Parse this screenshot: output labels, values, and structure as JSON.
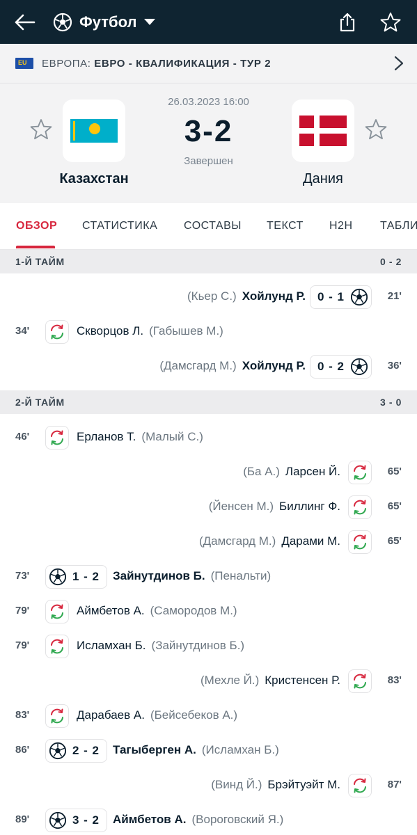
{
  "topbar": {
    "sport": "Футбол"
  },
  "league": {
    "country": "ЕВРОПА:",
    "competition": "ЕВРО - КВАЛИФИКАЦИЯ - ТУР 2",
    "flag_label": "EU"
  },
  "match": {
    "datetime": "26.03.2023 16:00",
    "score": "3-2",
    "status": "Завершен",
    "home": "Казахстан",
    "away": "Дания"
  },
  "tabs": [
    "ОБЗОР",
    "СТАТИСТИКА",
    "СОСТАВЫ",
    "ТЕКСТ",
    "H2H",
    "ТАБЛИ"
  ],
  "sections": [
    {
      "label": "1-Й ТАЙМ",
      "score": "0 - 2"
    },
    {
      "label": "2-Й ТАЙМ",
      "score": "3 - 0"
    }
  ],
  "events_half1": [
    {
      "side": "away",
      "type": "goal",
      "minute": "21'",
      "player": "Хойлунд Р.",
      "assist": "(Кьер С.)",
      "score": "0 - 1"
    },
    {
      "side": "home",
      "type": "sub",
      "minute": "34'",
      "player": "Скворцов Л.",
      "assist": "(Габышев М.)"
    },
    {
      "side": "away",
      "type": "goal",
      "minute": "36'",
      "player": "Хойлунд Р.",
      "assist": "(Дамсгард М.)",
      "score": "0 - 2"
    }
  ],
  "events_half2": [
    {
      "side": "home",
      "type": "sub",
      "minute": "46'",
      "player": "Ерланов Т.",
      "assist": "(Малый С.)"
    },
    {
      "side": "away",
      "type": "sub",
      "minute": "65'",
      "player": "Ларсен Й.",
      "assist": "(Ба А.)"
    },
    {
      "side": "away",
      "type": "sub",
      "minute": "65'",
      "player": "Биллинг Ф.",
      "assist": "(Йенсен М.)"
    },
    {
      "side": "away",
      "type": "sub",
      "minute": "65'",
      "player": "Дарами М.",
      "assist": "(Дамсгард М.)"
    },
    {
      "side": "home",
      "type": "goal",
      "minute": "73'",
      "player": "Зайнутдинов Б.",
      "assist": "(Пенальти)",
      "score": "1 - 2"
    },
    {
      "side": "home",
      "type": "sub",
      "minute": "79'",
      "player": "Аймбетов А.",
      "assist": "(Самородов М.)"
    },
    {
      "side": "home",
      "type": "sub",
      "minute": "79'",
      "player": "Исламхан Б.",
      "assist": "(Зайнутдинов Б.)"
    },
    {
      "side": "away",
      "type": "sub",
      "minute": "83'",
      "player": "Кристенсен Р.",
      "assist": "(Мехле Й.)"
    },
    {
      "side": "home",
      "type": "sub",
      "minute": "83'",
      "player": "Дарабаев А.",
      "assist": "(Бейсебеков А.)"
    },
    {
      "side": "home",
      "type": "goal",
      "minute": "86'",
      "player": "Тагыберген А.",
      "assist": "(Исламхан Б.)",
      "score": "2 - 2"
    },
    {
      "side": "away",
      "type": "sub",
      "minute": "87'",
      "player": "Брэйтуэйт М.",
      "assist": "(Винд Й.)"
    },
    {
      "side": "home",
      "type": "goal",
      "minute": "89'",
      "player": "Аймбетов А.",
      "assist": "(Вороговский Я.)",
      "score": "3 - 2"
    }
  ],
  "colors": {
    "topbar": "#0f2431",
    "accent": "#d7263d",
    "sub_green": "#2fa84f",
    "sub_red": "#d7263d"
  }
}
